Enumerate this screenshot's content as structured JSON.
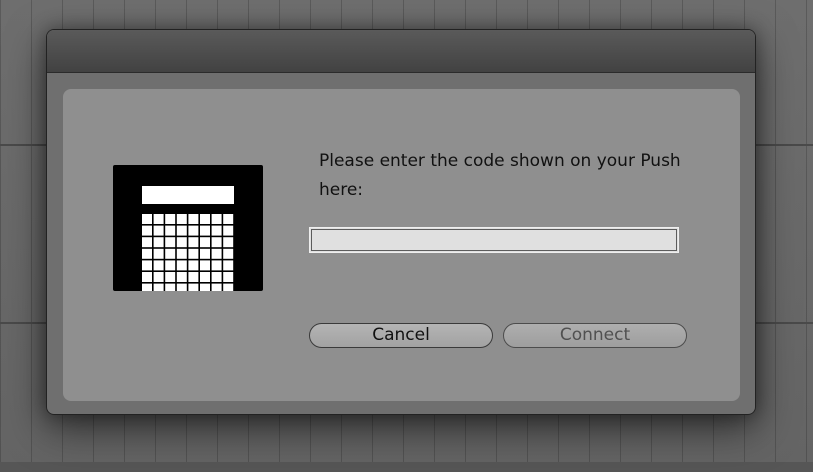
{
  "dialog": {
    "title": "",
    "prompt": "Please enter the code shown on your Push here:",
    "code_input": {
      "value": "",
      "placeholder": ""
    },
    "buttons": {
      "cancel_label": "Cancel",
      "connect_label": "Connect"
    },
    "icon": "push-device-icon"
  },
  "colors": {
    "panel": "#8f8f8f",
    "titlebar": "#4a4a4a",
    "input_background": "#e0e0e0",
    "button_background": "#a8a8a8",
    "disabled_text": "#505050"
  }
}
